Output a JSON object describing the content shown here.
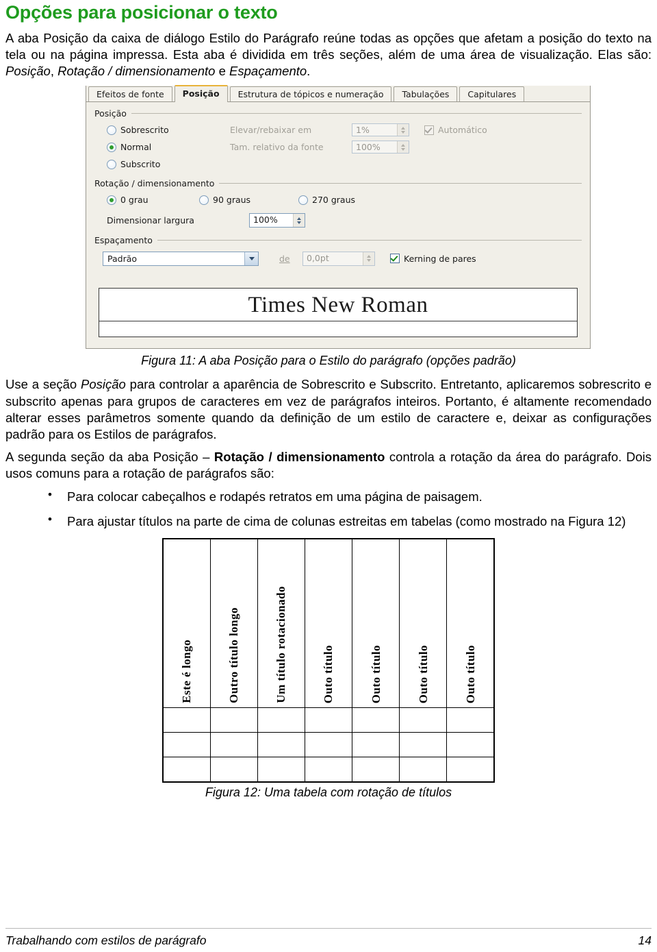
{
  "heading": "Opções para posicionar o texto",
  "intro_paragraph": {
    "part1": "A aba Posição da caixa de diálogo Estilo do Parágrafo reúne todas as opções que afetam a posição do texto na tela ou na página impressa. Esta aba é dividida em três seções, além de uma área de visualização. Elas são: ",
    "italic1": "Posição",
    "sep1": ", ",
    "italic2": "Rotação / dimensionamento",
    "sep2": " e ",
    "italic3": "Espaçamento",
    "end": "."
  },
  "dialog": {
    "tabs": [
      {
        "label": "Efeitos de fonte",
        "active": false
      },
      {
        "label": "Posição",
        "active": true
      },
      {
        "label": "Estrutura de tópicos e numeração",
        "active": false
      },
      {
        "label": "Tabulações",
        "active": false
      },
      {
        "label": "Capitulares",
        "active": false
      }
    ],
    "position_group": {
      "title": "Posição",
      "radio_superscript": "Sobrescrito",
      "radio_normal": "Normal",
      "radio_subscript": "Subscrito",
      "selected": "Normal",
      "raise_lower_label": "Elevar/rebaixar em",
      "raise_lower_value": "1%",
      "automatic_label": "Automático",
      "automatic_checked": true,
      "rel_font_size_label": "Tam. relativo da fonte",
      "rel_font_size_value": "100%"
    },
    "rotation_group": {
      "title": "Rotação / dimensionamento",
      "radio_0": "0 grau",
      "radio_90": "90 graus",
      "radio_270": "270 graus",
      "selected": "0 grau",
      "scale_width_label": "Dimensionar largura",
      "scale_width_value": "100%"
    },
    "spacing_group": {
      "title": "Espaçamento",
      "combo_value": "Padrão",
      "by_label": "de",
      "by_value": "0,0pt",
      "kerning_label": "Kerning de pares",
      "kerning_checked": true
    },
    "preview_text": "Times New Roman"
  },
  "figure11_caption": "Figura 11:  A aba Posição para o Estilo do parágrafo (opções padrão)",
  "body_paragraph_2": {
    "p1": "Use a seção ",
    "i1": "Posição",
    "p2": " para controlar a aparência de Sobrescrito e Subscrito. Entretanto, aplicaremos sobrescrito e subscrito apenas para grupos de caracteres em vez de parágrafos inteiros. Portanto, é altamente recomendado alterar esses parâmetros somente quando da definição de um estilo de caractere e, deixar as configurações padrão para os Estilos de parágrafos."
  },
  "body_paragraph_3": {
    "p1": "A segunda seção da aba Posição – ",
    "b1": "Rotação / dimensionamento",
    "p2": " controla a rotação da área do parágrafo. Dois usos comuns para a rotação de parágrafos são:"
  },
  "bullets": [
    "Para colocar cabeçalhos e rodapés retratos em uma página de paisagem.",
    "Para ajustar títulos na parte de cima de colunas estreitas em tabelas (como mostrado na Figura 12)"
  ],
  "figure12": {
    "headers": [
      "Este é longo",
      "Outro título longo",
      "Um título rotacionado",
      "Outo título",
      "Outo título",
      "Outo título",
      "Outo título"
    ],
    "empty_rows": 3,
    "caption": "Figura 12: Uma tabela com rotação de títulos"
  },
  "footer": {
    "left": "Trabalhando com estilos de parágrafo",
    "page": "14"
  },
  "colors": {
    "heading_green": "#1f9c1f",
    "tab_active_accent": "#e8b33a",
    "dialog_bg": "#f1efe8",
    "radio_dot": "#2f9e2f",
    "check_mark": "#1d8b1d"
  }
}
